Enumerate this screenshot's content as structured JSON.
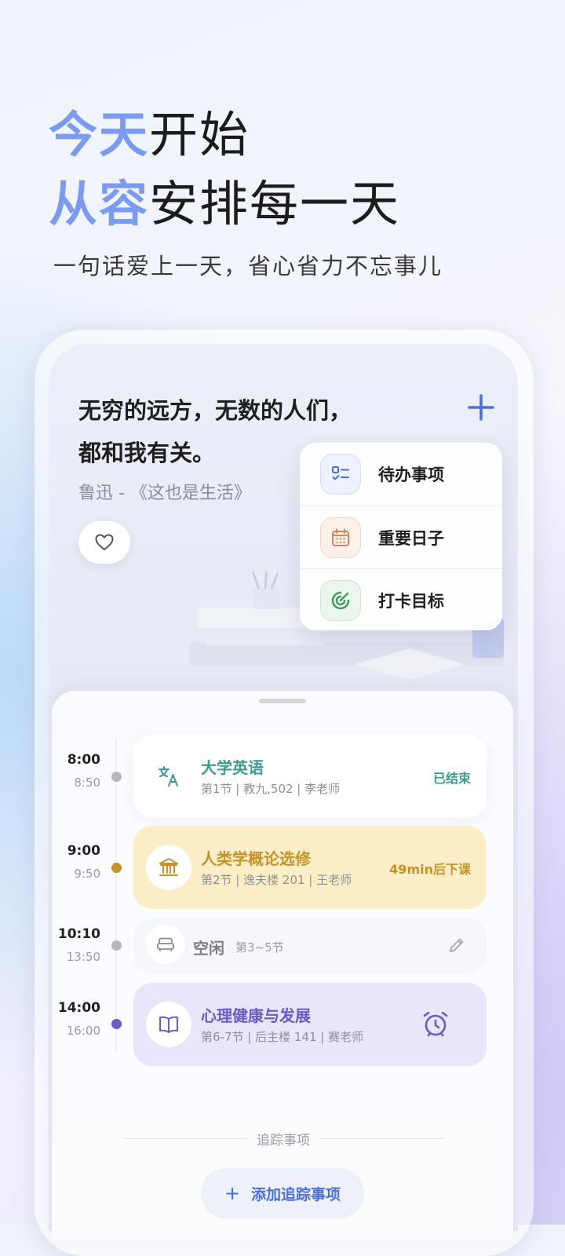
{
  "hero": {
    "line1_accent": "今天",
    "line1_rest": "开始",
    "line2_accent": "从容",
    "line2_rest": "安排每一天",
    "subtitle": "一句话爱上一天，省心省力不忘事儿"
  },
  "quote": {
    "line1": "无穷的远方，无数的人们，",
    "line2": "都和我有关。",
    "author": "鲁迅 - 《这也是生活》"
  },
  "add_menu": {
    "items": [
      {
        "label": "待办事项",
        "icon": "checklist-icon",
        "color": "#4a6fd6"
      },
      {
        "label": "重要日子",
        "icon": "calendar-icon",
        "color": "#d9825b"
      },
      {
        "label": "打卡目标",
        "icon": "target-icon",
        "color": "#3d9a5a"
      }
    ]
  },
  "schedule": {
    "items": [
      {
        "start": "8:00",
        "end": "8:50",
        "title": "大学英语",
        "detail": "第1节 | 教九,502 | 李老师",
        "status": "已结束",
        "icon": "translate-icon",
        "color": "#3c9a8f"
      },
      {
        "start": "9:00",
        "end": "9:50",
        "title": "人类学概论选修",
        "detail": "第2节 | 逸夫楼 201 | 王老师",
        "status": "49min后下课",
        "icon": "museum-icon",
        "color": "#c4932a"
      },
      {
        "start": "10:10",
        "end": "13:50",
        "title": "空闲",
        "detail": "第3~5节",
        "icon": "sofa-icon",
        "color": "#7d8089"
      },
      {
        "start": "14:00",
        "end": "16:00",
        "title": "心理健康与发展",
        "detail": "第6-7节 | 后主楼 141 | 赛老师",
        "icon": "book-icon",
        "status_icon": "alarm-icon",
        "color": "#6a5bc7"
      }
    ]
  },
  "tracking": {
    "section_label": "追踪事项",
    "add_label": "添加追踪事项"
  }
}
